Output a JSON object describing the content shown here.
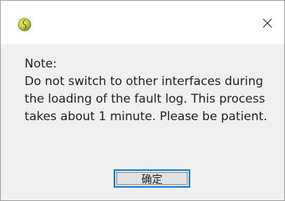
{
  "window": {
    "app_icon": "app-icon-yellow-green-circle",
    "close_icon": "close-icon",
    "close_glyph": "✕"
  },
  "dialog": {
    "title_label": "Note:",
    "message": "Do not switch to other interfaces during the loading of the fault log. This process takes about 1 minute. Please be patient.",
    "ok_label": "确定"
  },
  "colors": {
    "title_bg": "#ffffff",
    "body_bg": "#f0f0f0",
    "button_bg": "#e1e1e1",
    "button_focus": "#0078d7",
    "text": "#1e1e1e"
  }
}
